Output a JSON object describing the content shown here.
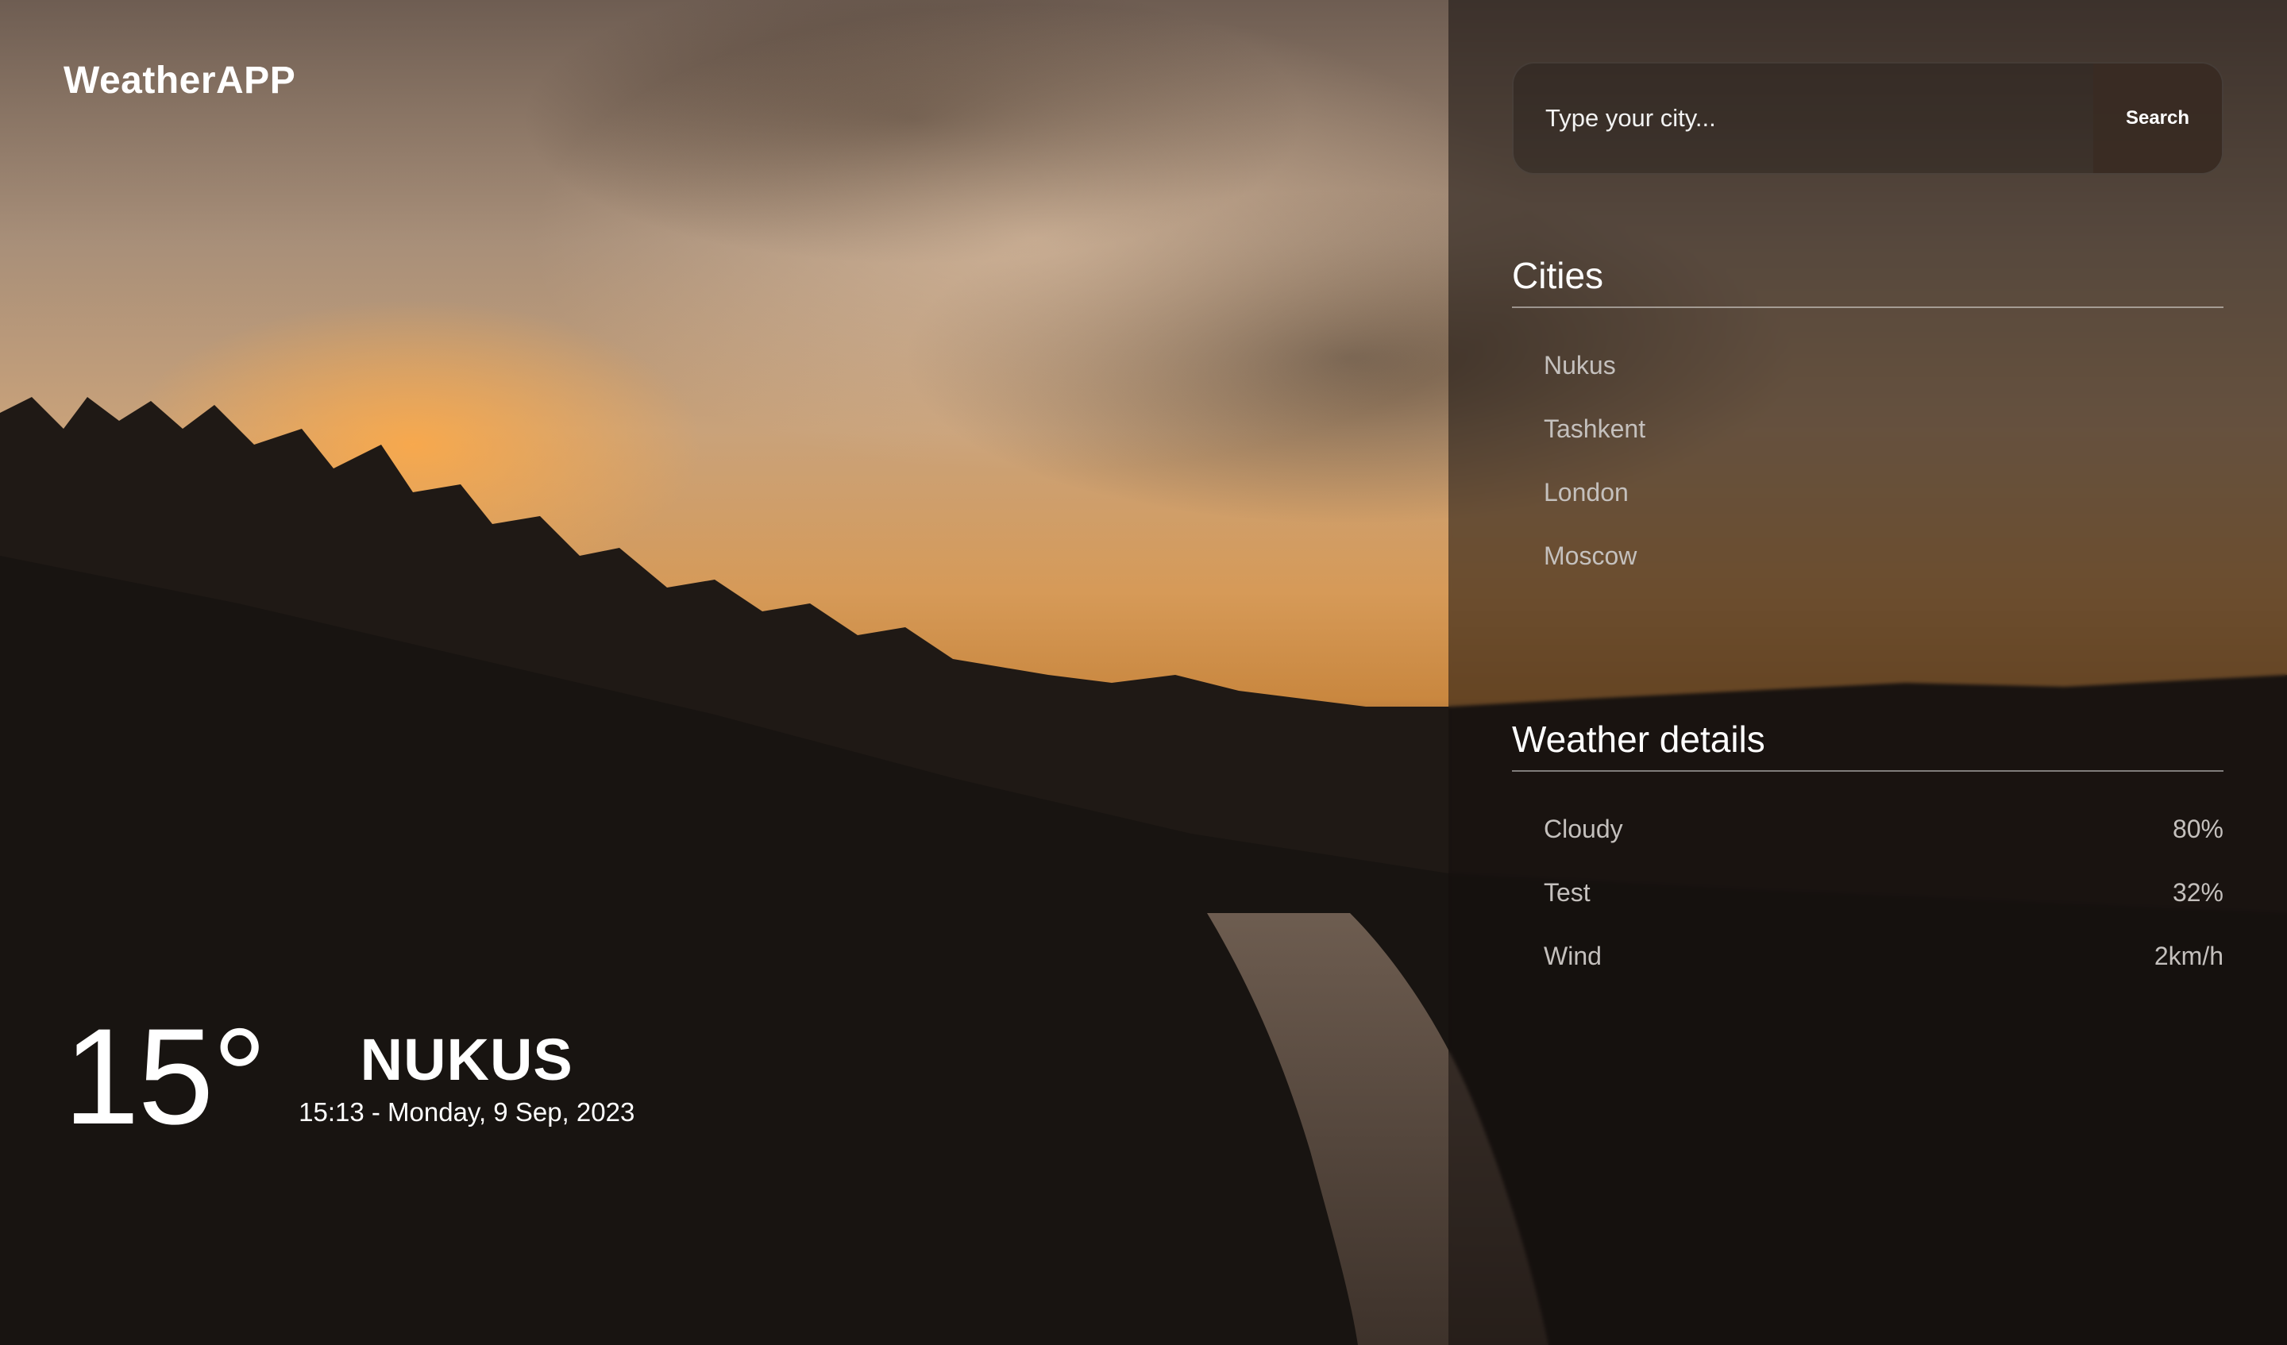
{
  "app": {
    "title": "WeatherAPP"
  },
  "search": {
    "placeholder": "Type your city...",
    "button_label": "Search"
  },
  "cities": {
    "title": "Cities",
    "items": [
      {
        "label": "Nukus"
      },
      {
        "label": "Tashkent"
      },
      {
        "label": "London"
      },
      {
        "label": "Moscow"
      }
    ]
  },
  "details": {
    "title": "Weather details",
    "items": [
      {
        "label": "Cloudy",
        "value": "80%"
      },
      {
        "label": "Test",
        "value": "32%"
      },
      {
        "label": "Wind",
        "value": "2km/h"
      }
    ]
  },
  "current": {
    "temperature": "15°",
    "city": "NUKUS",
    "datetime": "15:13 - Monday, 9 Sep, 2023"
  },
  "colors": {
    "text_primary": "#ffffff",
    "text_muted": "#c4c0bd",
    "search_button_bg": "#3a2c24",
    "sidebar_overlay": "#140f0c"
  }
}
